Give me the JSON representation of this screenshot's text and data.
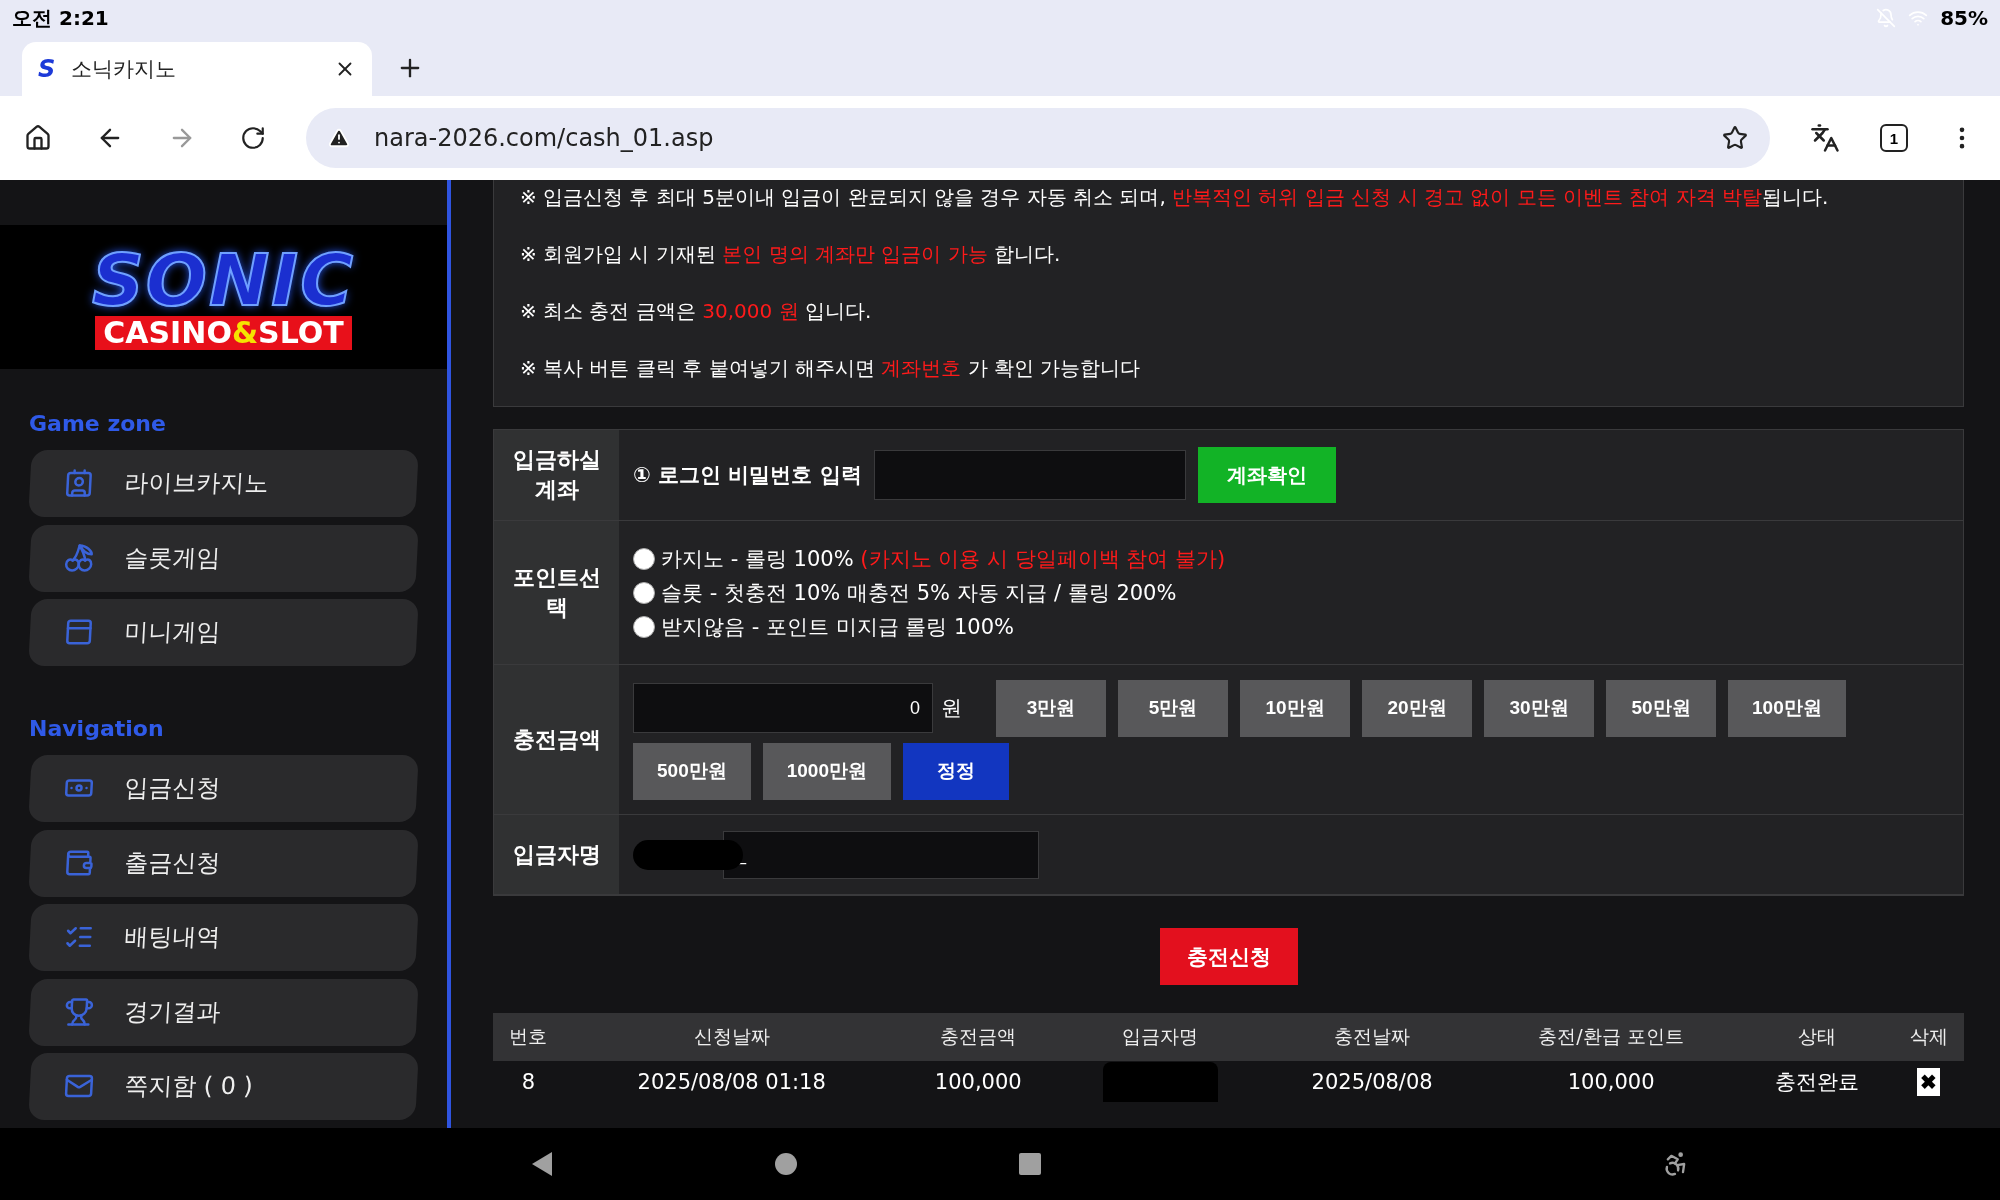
{
  "status_bar": {
    "time": "오전 2:21",
    "battery": "85%"
  },
  "browser": {
    "tab": {
      "favicon": "S",
      "title": "소닉카지노"
    },
    "url": "nara-2026.com/cash_01.asp",
    "tab_count": "1"
  },
  "logo": {
    "top": "SONIC",
    "bottom_left": "CASINO",
    "amp": "&",
    "bottom_right": "SLOT"
  },
  "sidebar": [
    {
      "heading": "Game zone",
      "items": [
        {
          "label": "라이브카지노"
        },
        {
          "label": "슬롯게임"
        },
        {
          "label": "미니게임"
        }
      ]
    },
    {
      "heading": "Navigation",
      "items": [
        {
          "label": "입금신청"
        },
        {
          "label": "출금신청"
        },
        {
          "label": "배팅내역"
        },
        {
          "label": "경기결과"
        },
        {
          "label": "쪽지함 ( 0 )"
        }
      ]
    }
  ],
  "notices": [
    [
      {
        "text": "※ 입금신청 후 최대 5분이내 입금이 완료되지 않을 경우 자동 취소 되며, ",
        "red": false
      },
      {
        "text": "반복적인 허위 입금 신청 시 경고 없이 모든 이벤트 참여 자격 박탈",
        "red": true
      },
      {
        "text": "됩니다.",
        "red": false
      }
    ],
    [
      {
        "text": "※ 회원가입 시 기재된 ",
        "red": false
      },
      {
        "text": "본인 명의 계좌만 입금이 가능",
        "red": true
      },
      {
        "text": " 합니다.",
        "red": false
      }
    ],
    [
      {
        "text": "※ 최소 충전 금액은 ",
        "red": false
      },
      {
        "text": "30,000 원",
        "red": true
      },
      {
        "text": " 입니다.",
        "red": false
      }
    ],
    [
      {
        "text": "※ 복사 버튼 클릭 후 붙여넣기 해주시면 ",
        "red": false
      },
      {
        "text": "계좌번호",
        "red": true
      },
      {
        "text": " 가 확인 가능합니다",
        "red": false
      }
    ]
  ],
  "form": {
    "account": {
      "label": "입금하실 계좌",
      "prompt": "① 로그인 비밀번호 입력",
      "button": "계좌확인"
    },
    "points": {
      "label": "포인트선택",
      "options": [
        {
          "text": "카지노 - 롤링 100%",
          "note": "(카지노 이용 시 당일페이백 참여 불가)",
          "selected": false
        },
        {
          "text": "슬롯 - 첫충전 10% 매충전 5% 자동 지급 / 롤링 200%",
          "selected": false
        },
        {
          "text": "받지않음 - 포인트 미지급 롤링 100%",
          "selected": false
        }
      ]
    },
    "amount": {
      "label": "충전금액",
      "value": "0",
      "unit": "원",
      "buttons": [
        {
          "label": "3만원",
          "kind": "amount"
        },
        {
          "label": "5만원",
          "kind": "amount"
        },
        {
          "label": "10만원",
          "kind": "amount"
        },
        {
          "label": "20만원",
          "kind": "amount"
        },
        {
          "label": "30만원",
          "kind": "amount"
        },
        {
          "label": "50만원",
          "kind": "amount"
        },
        {
          "label": "100만원",
          "kind": "amount"
        },
        {
          "label": "500만원",
          "kind": "amount"
        },
        {
          "label": "1000만원",
          "kind": "amount"
        },
        {
          "label": "정정",
          "kind": "reset"
        }
      ]
    },
    "depositor": {
      "label": "입금자명",
      "value": "_"
    },
    "submit": "충전신청"
  },
  "table": {
    "columns": [
      "번호",
      "신청날짜",
      "충전금액",
      "입금자명",
      "충전날짜",
      "충전/환급 포인트",
      "상태",
      "삭제"
    ],
    "rows": [
      [
        "8",
        "2025/08/08 01:18",
        "100,000",
        "",
        "2025/08/08",
        "100,000",
        "충전완료",
        "✖"
      ]
    ]
  }
}
